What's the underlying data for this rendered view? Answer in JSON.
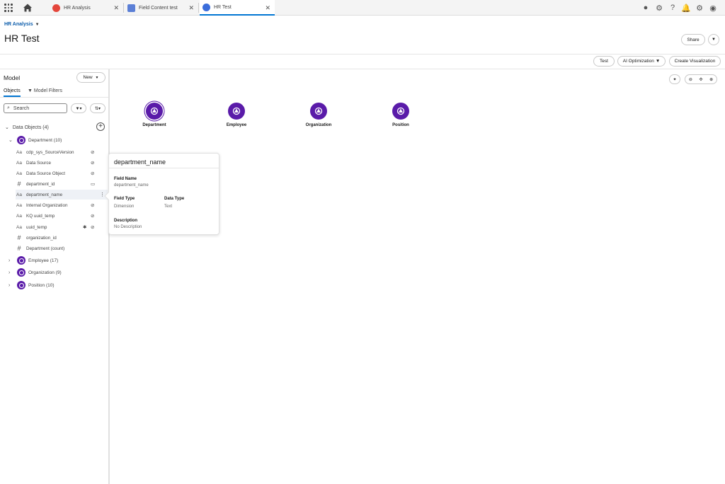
{
  "tabs": [
    {
      "label": "HR Analysis",
      "color": "#e4463b"
    },
    {
      "label": "Field Content test",
      "color": "#5b7fd6"
    },
    {
      "label": "HR Test",
      "color": "#3b6ddb"
    }
  ],
  "header": {
    "breadcrumb": "HR Analysis",
    "title": "HR Test",
    "share_label": "Share"
  },
  "actions": {
    "test_label": "Test",
    "ai_label": "AI Optimization",
    "create_label": "Create Visualization"
  },
  "left": {
    "model_title": "Model",
    "new_label": "New",
    "tab_objects": "Objects",
    "tab_filters": "Model Filters",
    "search_placeholder": "Search",
    "data_objects_label": "Data Objects (4)",
    "objects": [
      {
        "label": "Department",
        "count": "(10)",
        "expanded": true
      },
      {
        "label": "Employee",
        "count": "(17)"
      },
      {
        "label": "Organization",
        "count": "(9)"
      },
      {
        "label": "Position",
        "count": "(10)"
      }
    ],
    "fields": [
      {
        "type": "Aa",
        "label": "cdp_sys_SourceVersion",
        "icon": "hidden"
      },
      {
        "type": "Aa",
        "label": "Data Source",
        "icon": "hidden"
      },
      {
        "type": "Aa",
        "label": "Data Source Object",
        "icon": "hidden"
      },
      {
        "type": "#",
        "label": "department_id",
        "icon": "monitor"
      },
      {
        "type": "Aa",
        "label": "department_name",
        "icon": "kebab"
      },
      {
        "type": "Aa",
        "label": "Internal Organization",
        "icon": "hidden"
      },
      {
        "type": "Aa",
        "label": "KQ uuid_temp",
        "icon": "hidden"
      },
      {
        "type": "Aa",
        "label": "uuid_temp",
        "icon": "hidden2"
      },
      {
        "type": "#",
        "label": "organization_id",
        "icon": ""
      },
      {
        "type": "#",
        "label": "Department (count)",
        "icon": ""
      }
    ]
  },
  "tooltip": {
    "title": "department_name",
    "field_name_label": "Field Name",
    "field_name_value": "department_name",
    "field_type_label": "Field Type",
    "field_type_value": "Dimension",
    "data_type_label": "Data Type",
    "data_type_value": "Text",
    "description_label": "Description",
    "description_value": "No Description"
  },
  "canvas": {
    "nodes": [
      "Department",
      "Employee",
      "Organization",
      "Position"
    ]
  },
  "colors": {
    "accent": "#0176d3",
    "object": "#5a1ba9"
  }
}
